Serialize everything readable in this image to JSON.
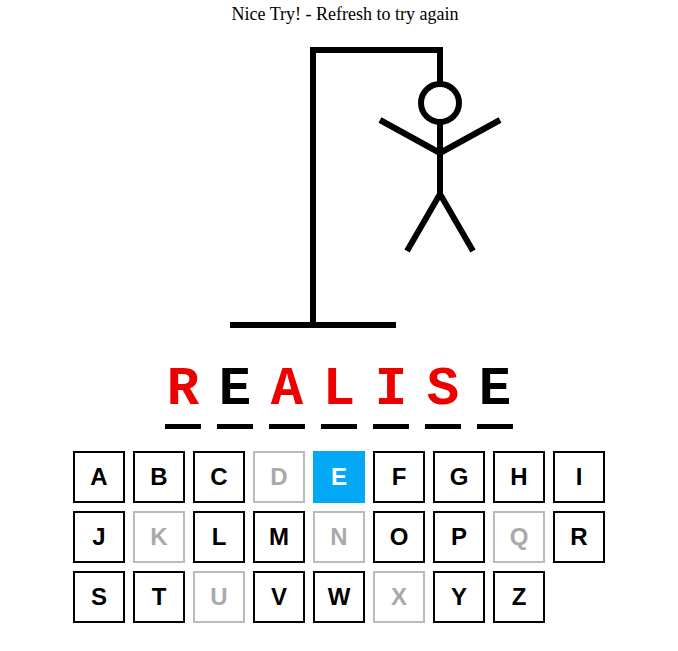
{
  "status": {
    "message": "Nice Try! - Refresh to try again"
  },
  "figure": {
    "parts": [
      {
        "name": "head",
        "shown": true
      },
      {
        "name": "body",
        "shown": true
      },
      {
        "name": "left-arm",
        "shown": true
      },
      {
        "name": "right-arm",
        "shown": true
      },
      {
        "name": "left-leg",
        "shown": true
      },
      {
        "name": "right-leg",
        "shown": true
      }
    ]
  },
  "word": [
    {
      "char": "R",
      "guessed": false
    },
    {
      "char": "E",
      "guessed": true
    },
    {
      "char": "A",
      "guessed": false
    },
    {
      "char": "L",
      "guessed": false
    },
    {
      "char": "I",
      "guessed": false
    },
    {
      "char": "S",
      "guessed": false
    },
    {
      "char": "E",
      "guessed": true
    }
  ],
  "keys": [
    {
      "label": "A",
      "selected": false,
      "disabled": false
    },
    {
      "label": "B",
      "selected": false,
      "disabled": false
    },
    {
      "label": "C",
      "selected": false,
      "disabled": false
    },
    {
      "label": "D",
      "selected": false,
      "disabled": true
    },
    {
      "label": "E",
      "selected": true,
      "disabled": false
    },
    {
      "label": "F",
      "selected": false,
      "disabled": false
    },
    {
      "label": "G",
      "selected": false,
      "disabled": false
    },
    {
      "label": "H",
      "selected": false,
      "disabled": false
    },
    {
      "label": "I",
      "selected": false,
      "disabled": false
    },
    {
      "label": "J",
      "selected": false,
      "disabled": false
    },
    {
      "label": "K",
      "selected": false,
      "disabled": true
    },
    {
      "label": "L",
      "selected": false,
      "disabled": false
    },
    {
      "label": "M",
      "selected": false,
      "disabled": false
    },
    {
      "label": "N",
      "selected": false,
      "disabled": true
    },
    {
      "label": "O",
      "selected": false,
      "disabled": false
    },
    {
      "label": "P",
      "selected": false,
      "disabled": false
    },
    {
      "label": "Q",
      "selected": false,
      "disabled": true
    },
    {
      "label": "R",
      "selected": false,
      "disabled": false
    },
    {
      "label": "S",
      "selected": false,
      "disabled": false
    },
    {
      "label": "T",
      "selected": false,
      "disabled": false
    },
    {
      "label": "U",
      "selected": false,
      "disabled": true
    },
    {
      "label": "V",
      "selected": false,
      "disabled": false
    },
    {
      "label": "W",
      "selected": false,
      "disabled": false
    },
    {
      "label": "X",
      "selected": false,
      "disabled": true
    },
    {
      "label": "Y",
      "selected": false,
      "disabled": false
    },
    {
      "label": "Z",
      "selected": false,
      "disabled": false
    }
  ]
}
